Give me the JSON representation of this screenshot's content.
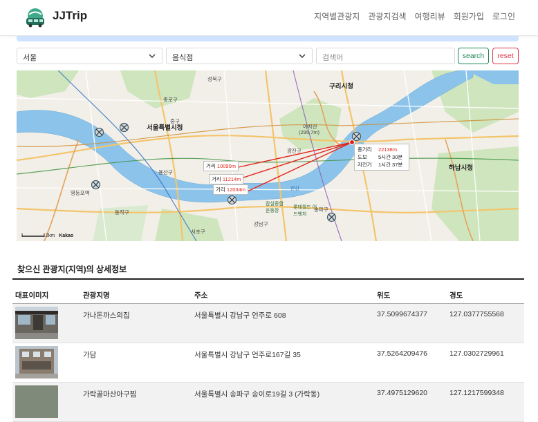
{
  "header": {
    "brand": "JJTrip",
    "nav": [
      "지역별관광지",
      "관광지검색",
      "여행리뷰",
      "회원가입",
      "로그인"
    ]
  },
  "search": {
    "region": "서울",
    "category": "음식점",
    "keyword_placeholder": "검색어",
    "search_label": "search",
    "reset_label": "reset"
  },
  "map": {
    "labels": {
      "seoul_city_hall": "서울특별시청",
      "guri": "구리시청",
      "hanam": "하남시청",
      "gangnam": "강남구",
      "seocho": "서초구",
      "songpa": "송파구",
      "yongsan": "용산구",
      "seongbuk": "성북구",
      "jongno": "종로구",
      "jung": "중구",
      "gwangjin": "광진구",
      "dongjak": "동작구",
      "achasan": "아차산",
      "achasan_height": "(295.7m)",
      "lotte": "롯데월드 어드벤처",
      "sports": "잠실종합 운동장",
      "yeouido": "영등포역",
      "hangang": "한강"
    },
    "distances": [
      {
        "label": "거리",
        "value": "10090m"
      },
      {
        "label": "거리",
        "value": "11214m"
      },
      {
        "label": "거리",
        "value": "12034m"
      }
    ],
    "info": [
      {
        "label": "총거리",
        "value": "22138m"
      },
      {
        "label": "도보",
        "value": "5시간 30분"
      },
      {
        "label": "자전거",
        "value": "1시간 37분"
      }
    ],
    "scale": "2km",
    "provider": "Kakao"
  },
  "results": {
    "title": "찾으신 관광지(지역)의 상세정보",
    "columns": [
      "대표이미지",
      "관광지명",
      "주소",
      "위도",
      "경도"
    ],
    "rows": [
      {
        "name": "가나돈까스의집",
        "address": "서울특별시 강남구 언주로 608",
        "lat": "37.5099674377",
        "lng": "127.0377755568"
      },
      {
        "name": "가담",
        "address": "서울특별시 강남구 언주로167길 35",
        "lat": "37.5264209476",
        "lng": "127.0302729961"
      },
      {
        "name": "가락골마산아구찜",
        "address": "서울특별시 송파구 송이로19길 3 (가락동)",
        "lat": "37.4975129620",
        "lng": "127.1217599348"
      }
    ]
  },
  "colors": {
    "search_btn": "#198754",
    "reset_btn": "#dc3545",
    "route": "#e1251b",
    "river": "#78b6e6",
    "alert": "#cfe2ff"
  }
}
